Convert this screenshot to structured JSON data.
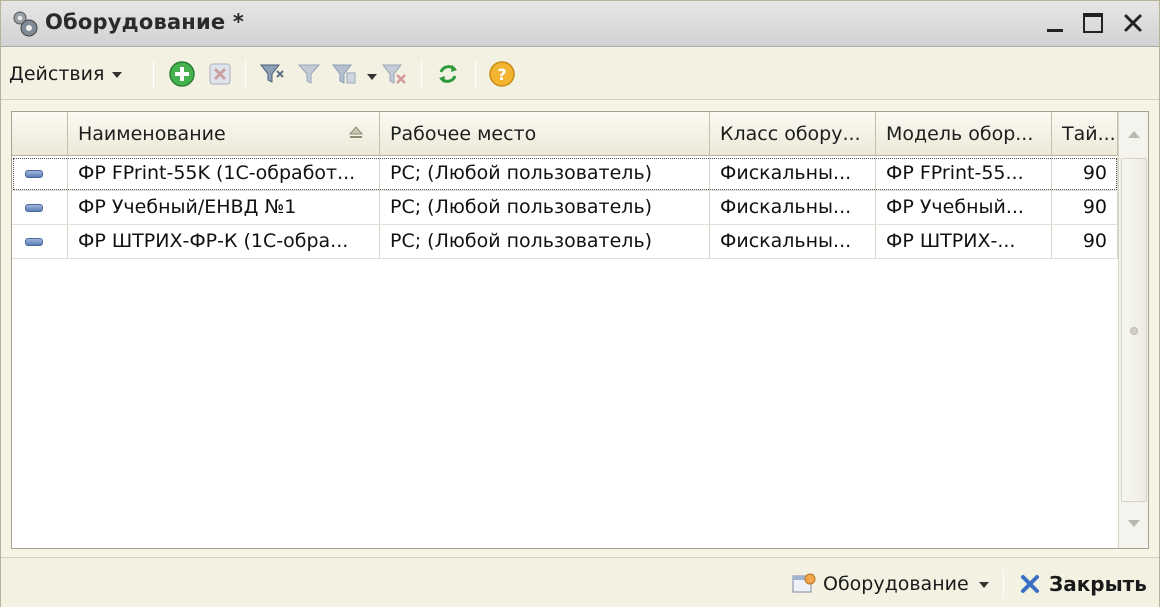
{
  "window": {
    "title": "Оборудование *",
    "minimize_icon": "minimize-icon",
    "maximize_icon": "maximize-icon",
    "close_icon": "close-icon"
  },
  "toolbar": {
    "actions_label": "Действия",
    "icons": [
      "add-icon",
      "delete-icon",
      "filter-set-icon",
      "filter-by-value-icon",
      "filter-history-icon",
      "filter-clear-icon",
      "refresh-icon",
      "help-icon"
    ]
  },
  "table": {
    "columns": [
      "Наименование",
      "Рабочее место",
      "Класс обору...",
      "Модель обор...",
      "Тай..."
    ],
    "rows": [
      [
        "ФР FPrint-55K (1С-обработ...",
        "РС; (Любой пользователь)",
        "Фискальны...",
        "ФР FPrint-55...",
        "90"
      ],
      [
        "ФР Учебный/ЕНВД №1",
        "РС; (Любой пользователь)",
        "Фискальны...",
        "ФР Учебный...",
        "90"
      ],
      [
        "ФР ШТРИХ-ФР-К (1С-обра...",
        "РС; (Любой пользователь)",
        "Фискальны...",
        "ФР ШТРИХ-...",
        "90"
      ]
    ]
  },
  "bottom": {
    "equipment_label": "Оборудование",
    "close_label": "Закрыть"
  },
  "colors": {
    "accent_green": "#3aa84a",
    "close_blue": "#3a6fc4",
    "help_orange": "#f0a020"
  }
}
